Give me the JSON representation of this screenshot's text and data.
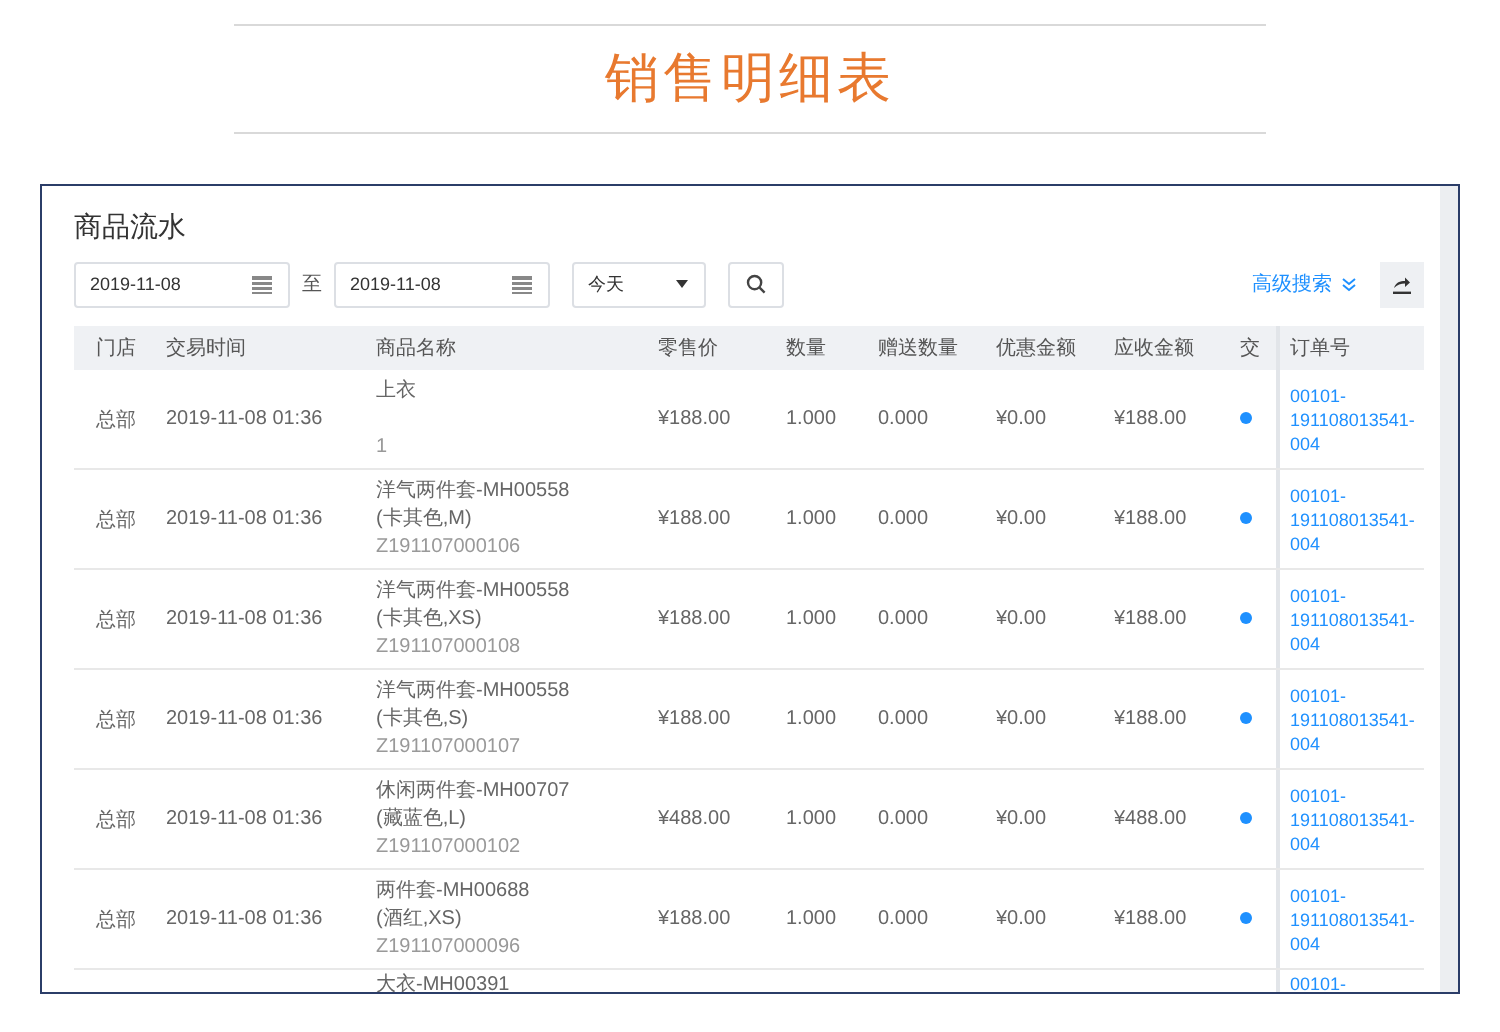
{
  "page_title": "销售明细表",
  "panel": {
    "title": "商品流水",
    "filters": {
      "date_from": "2019-11-08",
      "separator": "至",
      "date_to": "2019-11-08",
      "period": "今天",
      "advanced_search": "高级搜索"
    },
    "table": {
      "columns": [
        "门店",
        "交易时间",
        "商品名称",
        "零售价",
        "数量",
        "赠送数量",
        "优惠金额",
        "应收金额",
        "交",
        "订单号"
      ],
      "rows": [
        {
          "store": "总部",
          "time": "2019-11-08 01:36",
          "name": "上衣",
          "code": "1",
          "price": "¥188.00",
          "qty": "1.000",
          "gift_qty": "0.000",
          "discount": "¥0.00",
          "receivable": "¥188.00",
          "order_no": "00101-191108013541-004"
        },
        {
          "store": "总部",
          "time": "2019-11-08 01:36",
          "name": "洋气两件套-MH00558",
          "spec": "(卡其色,M)",
          "code": "Z191107000106",
          "price": "¥188.00",
          "qty": "1.000",
          "gift_qty": "0.000",
          "discount": "¥0.00",
          "receivable": "¥188.00",
          "order_no": "00101-191108013541-004"
        },
        {
          "store": "总部",
          "time": "2019-11-08 01:36",
          "name": "洋气两件套-MH00558",
          "spec": "(卡其色,XS)",
          "code": "Z191107000108",
          "price": "¥188.00",
          "qty": "1.000",
          "gift_qty": "0.000",
          "discount": "¥0.00",
          "receivable": "¥188.00",
          "order_no": "00101-191108013541-004"
        },
        {
          "store": "总部",
          "time": "2019-11-08 01:36",
          "name": "洋气两件套-MH00558",
          "spec": "(卡其色,S)",
          "code": "Z191107000107",
          "price": "¥188.00",
          "qty": "1.000",
          "gift_qty": "0.000",
          "discount": "¥0.00",
          "receivable": "¥188.00",
          "order_no": "00101-191108013541-004"
        },
        {
          "store": "总部",
          "time": "2019-11-08 01:36",
          "name": "休闲两件套-MH00707",
          "spec": "(藏蓝色,L)",
          "code": "Z191107000102",
          "price": "¥488.00",
          "qty": "1.000",
          "gift_qty": "0.000",
          "discount": "¥0.00",
          "receivable": "¥488.00",
          "order_no": "00101-191108013541-004"
        },
        {
          "store": "总部",
          "time": "2019-11-08 01:36",
          "name": "两件套-MH00688",
          "spec": "(酒红,XS)",
          "code": "Z191107000096",
          "price": "¥188.00",
          "qty": "1.000",
          "gift_qty": "0.000",
          "discount": "¥0.00",
          "receivable": "¥188.00",
          "order_no": "00101-191108013541-004"
        }
      ],
      "cut_row": {
        "name": "大衣-MH00391",
        "order_no": "00101-"
      }
    }
  }
}
